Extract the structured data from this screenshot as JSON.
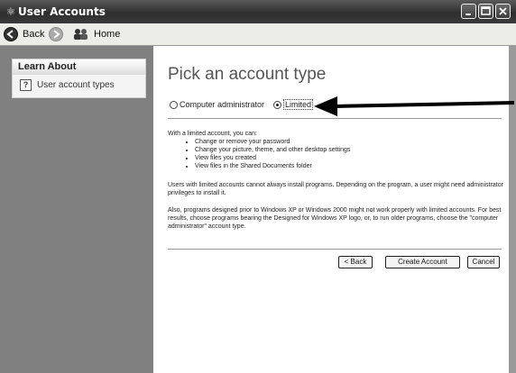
{
  "window": {
    "title": "User Accounts",
    "title_icon": "user-accounts-icon"
  },
  "toolbar": {
    "back_label": "Back",
    "home_label": "Home"
  },
  "sidebar": {
    "panel_title": "Learn About",
    "items": [
      {
        "label": "User account types",
        "icon": "help-icon"
      }
    ]
  },
  "main": {
    "heading": "Pick an account type",
    "options": [
      {
        "label": "Computer administrator",
        "selected": false
      },
      {
        "label": "Limited",
        "selected": true
      }
    ],
    "intro": "With a limited account, you can:",
    "bullets": [
      "Change or remove your password",
      "Change your picture, theme, and other desktop settings",
      "View files you created",
      "View files in the Shared Documents folder"
    ],
    "para1": "Users with limited accounts cannot always install programs. Depending on the program, a user might need administrator privileges to install it.",
    "para2": "Also, programs designed prior to Windows XP or Windows 2000 might not work properly with limited accounts. For best results, choose programs bearing the Designed for Windows XP logo, or, to run older programs, choose the \"computer administrator\" account type.",
    "buttons": {
      "back": "< Back",
      "create": "Create Account",
      "cancel": "Cancel"
    }
  },
  "annotation": {
    "type": "arrow",
    "points_to": "Limited"
  }
}
